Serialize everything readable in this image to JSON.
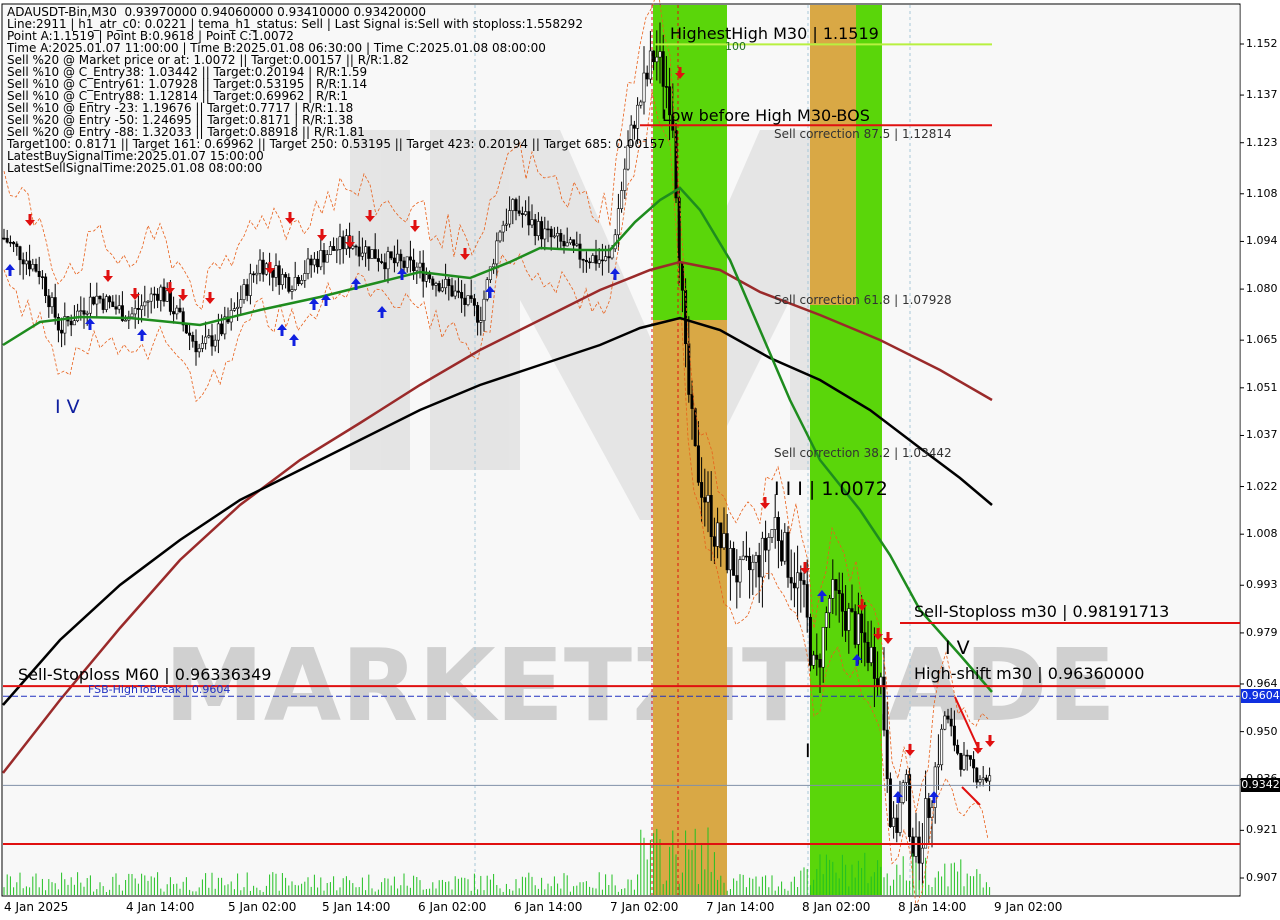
{
  "symbol_line": "ADAUSDT-Bin,M30  0.93970000 0.94060000 0.93410000 0.93420000",
  "info_lines": [
    "Line:2911 | h1_atr_c0: 0.0221 | tema_h1_status: Sell | Last Signal is:Sell with stoploss:1.558292",
    "Point A:1.1519 | Point B:0.9618 | Point C:1.0072",
    "Time A:2025.01.07 11:00:00 | Time B:2025.01.08 06:30:00 | Time C:2025.01.08 08:00:00",
    "Sell %20 @ Market price or at: 1.0072 || Target:0.00157 || R/R:1.82",
    "Sell %10 @ C_Entry38: 1.03442 || Target:0.20194 | R/R:1.59",
    "Sell %10 @ C_Entry61: 1.07928 || Target:0.53195 | R/R:1.14",
    "Sell %10 @ C_Entry88: 1.12814 || Target:0.69962 | R/R:1",
    "Sell %10 @ Entry -23: 1.19676 || Target:0.7717 | R/R:1.18",
    "Sell %20 @ Entry -50: 1.24695 || Target:0.8171 | R/R:1.38",
    "Sell %20 @ Entry -88: 1.32033 || Target:0.88918 || R/R:1.81",
    "Target100: 0.8171 || Target 161: 0.69962 || Target 250: 0.53195 || Target 423: 0.20194 || Target 685: 0.00157",
    "LatestBuySignalTime:2025.01.07 15:00:00",
    "LatestSellSignalTime:2025.01.08 08:00:00"
  ],
  "price_axis": [
    "1.152",
    "1.137",
    "1.123",
    "1.108",
    "1.094",
    "1.080",
    "1.065",
    "1.051",
    "1.037",
    "1.022",
    "1.008",
    "0.993",
    "0.979",
    "0.964",
    "0.950",
    "0.936",
    "0.921",
    "0.907"
  ],
  "price_tags": [
    {
      "text": "0.9604",
      "color": "#1030e0",
      "value": 0.9604
    },
    {
      "text": "0.9342",
      "color": "#000000",
      "value": 0.9342
    }
  ],
  "time_axis": [
    "4 Jan 2025",
    "4 Jan 14:00",
    "5 Jan 02:00",
    "5 Jan 14:00",
    "6 Jan 02:00",
    "6 Jan 14:00",
    "7 Jan 02:00",
    "7 Jan 14:00",
    "8 Jan 02:00",
    "8 Jan 14:00",
    "9 Jan 02:00"
  ],
  "annotations": {
    "highest_high": "HighestHigh   M30 | 1.1519",
    "label_100": "100",
    "low_before_high": "Low before High   M30-BOS",
    "sell_corr_875": "Sell correction 87.5 | 1.12814",
    "sell_corr_618": "Sell correction 61.8 | 1.07928",
    "sell_corr_382": "Sell correction 38.2 | 1.03442",
    "wave_iii": "I I I | 1.0072",
    "wave_iv_left": "I V",
    "wave_iv_right": "I V",
    "wave_i": "I",
    "stoploss_m30": "Sell-Stoploss m30 | 0.98191713",
    "stoploss_m60": "Sell-Stoploss M60 | 0.96336349",
    "fsb_high": "FSB-HighToBreak | 0.9604",
    "high_shift": "High-shift m30 | 0.96360000",
    "watermark": "MARKETZITRADE"
  },
  "colors": {
    "green_zone": "#5ad60a",
    "orange_zone": "#f0a050",
    "ema_green": "#1e8c1e",
    "ema_brown": "#9a2a2a",
    "ema_black": "#000000",
    "sell_arrow": "#e01010",
    "buy_arrow": "#1020e0",
    "stoploss_red": "#e01010",
    "fsb_blue": "#2030c0"
  },
  "chart_data": {
    "type": "candlestick",
    "title": "ADAUSDT-Bin,M30",
    "ylim": [
      0.9,
      1.16
    ],
    "key_levels": {
      "highest_high": 1.1519,
      "low_before_high": 1.12814,
      "sell_correction_875": 1.12814,
      "sell_correction_618": 1.07928,
      "sell_correction_382": 1.03442,
      "point_c": 1.0072,
      "sell_stoploss_m30": 0.98191713,
      "sell_stoploss_m60": 0.96336349,
      "high_shift_m30": 0.9636,
      "fsb_high_to_break": 0.9604,
      "last_close": 0.9342,
      "support_line": 0.917
    },
    "ohlc_last": {
      "open": 0.9397,
      "high": 0.9406,
      "low": 0.9341,
      "close": 0.9342
    },
    "close_path": [
      {
        "x": "4 Jan 2025",
        "y": 1.095
      },
      {
        "x": "4 Jan 14:00",
        "y": 1.072
      },
      {
        "x": "5 Jan 02:00",
        "y": 1.067
      },
      {
        "x": "5 Jan 14:00",
        "y": 1.085
      },
      {
        "x": "6 Jan 02:00",
        "y": 1.088
      },
      {
        "x": "6 Jan 14:00",
        "y": 1.098
      },
      {
        "x": "7 Jan 02:00",
        "y": 1.09
      },
      {
        "x": "7 Jan 11:00",
        "y": 1.1519
      },
      {
        "x": "7 Jan 14:00",
        "y": 1.04
      },
      {
        "x": "8 Jan 02:00",
        "y": 0.995
      },
      {
        "x": "8 Jan 06:30",
        "y": 0.9618
      },
      {
        "x": "8 Jan 08:00",
        "y": 1.0072
      },
      {
        "x": "8 Jan 14:00",
        "y": 0.965
      },
      {
        "x": "8 Jan 20:00",
        "y": 0.912
      },
      {
        "x": "9 Jan 02:00",
        "y": 0.937
      }
    ]
  }
}
